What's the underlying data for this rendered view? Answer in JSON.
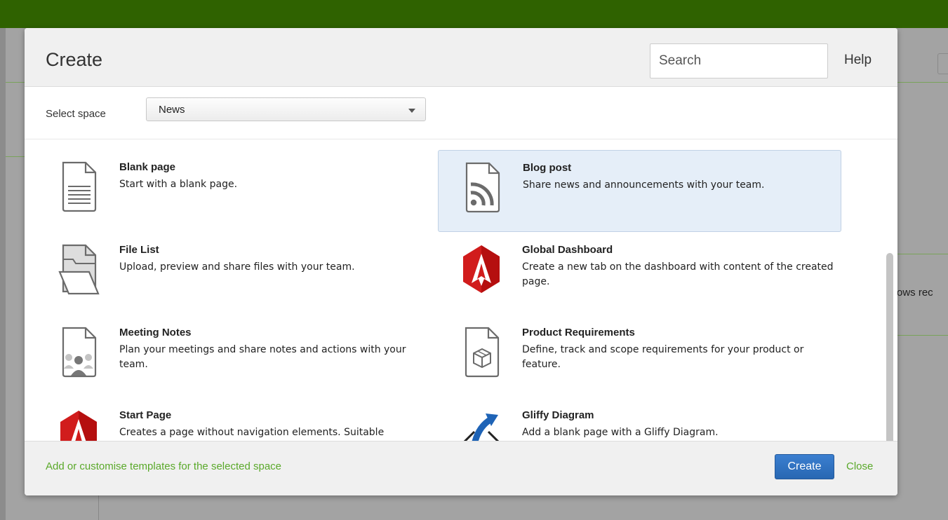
{
  "background": {
    "partial_text": "ows rec"
  },
  "dialog": {
    "title": "Create",
    "search_placeholder": "Search",
    "help_label": "Help",
    "space_label": "Select space",
    "space_selected": "News",
    "templates": [
      {
        "title": "Blank page",
        "description": "Start with a blank page.",
        "icon": "blank-page-icon",
        "selected": false
      },
      {
        "title": "Blog post",
        "description": "Share news and announcements with your team.",
        "icon": "rss-icon",
        "selected": true
      },
      {
        "title": "File List",
        "description": "Upload, preview and share files with your team.",
        "icon": "folder-icon",
        "selected": false
      },
      {
        "title": "Global Dashboard",
        "description": "Create a new tab on the dashboard with content of the created page.",
        "icon": "dashboard-hexagon-icon",
        "selected": false
      },
      {
        "title": "Meeting Notes",
        "description": "Plan your meetings and share notes and actions with your team.",
        "icon": "meeting-people-icon",
        "selected": false
      },
      {
        "title": "Product Requirements",
        "description": "Define, track and scope requirements for your product or feature.",
        "icon": "product-box-icon",
        "selected": false
      },
      {
        "title": "Start Page",
        "description": "Creates a page without navigation elements. Suitable",
        "icon": "start-page-hexagon-icon",
        "selected": false
      },
      {
        "title": "Gliffy Diagram",
        "description": "Add a blank page with a Gliffy Diagram.",
        "icon": "gliffy-icon",
        "selected": false
      }
    ],
    "footer": {
      "customise_link": "Add or customise templates for the selected space",
      "create_button": "Create",
      "close_link": "Close"
    }
  },
  "colors": {
    "topbar": "#2f6200",
    "accent_link": "#5aa92a",
    "primary_button": "#2867b2",
    "selected_tile": "#e5eef8"
  }
}
